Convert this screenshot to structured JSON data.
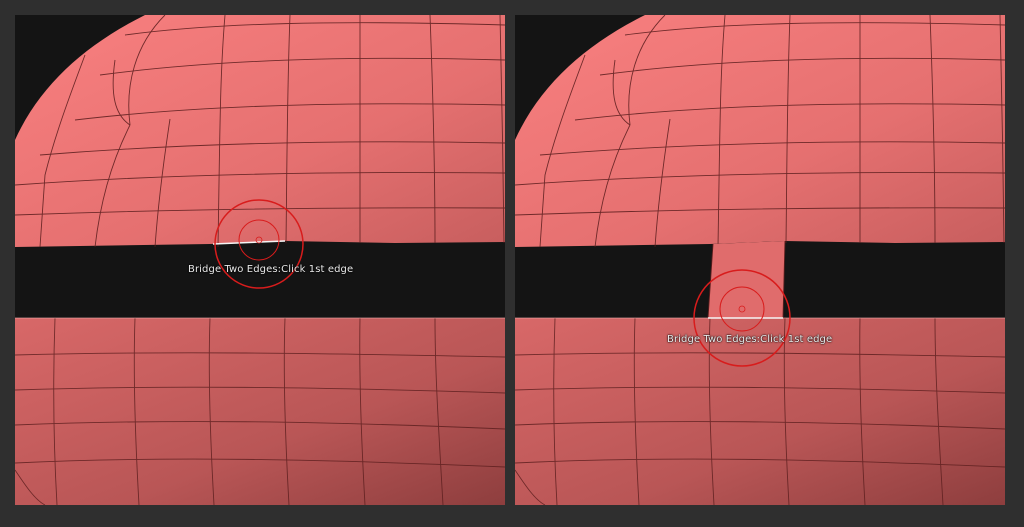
{
  "panels": [
    {
      "id": "left",
      "status": "Bridge Two Edges:Click 1st edge"
    },
    {
      "id": "right",
      "status": "Bridge Two Edges:Click 1st edge"
    }
  ],
  "colors": {
    "mesh_light": "#f07a7a",
    "mesh_dark": "#a94a4a",
    "wire": "#5a1d1d",
    "gap": "#141414",
    "cursor_ring": "#d81c1c",
    "selected_edge": "#f5f5f5",
    "frame_bg": "#2f2f2f"
  },
  "icons": {
    "brush_cursor": "brush-cursor-icon"
  }
}
